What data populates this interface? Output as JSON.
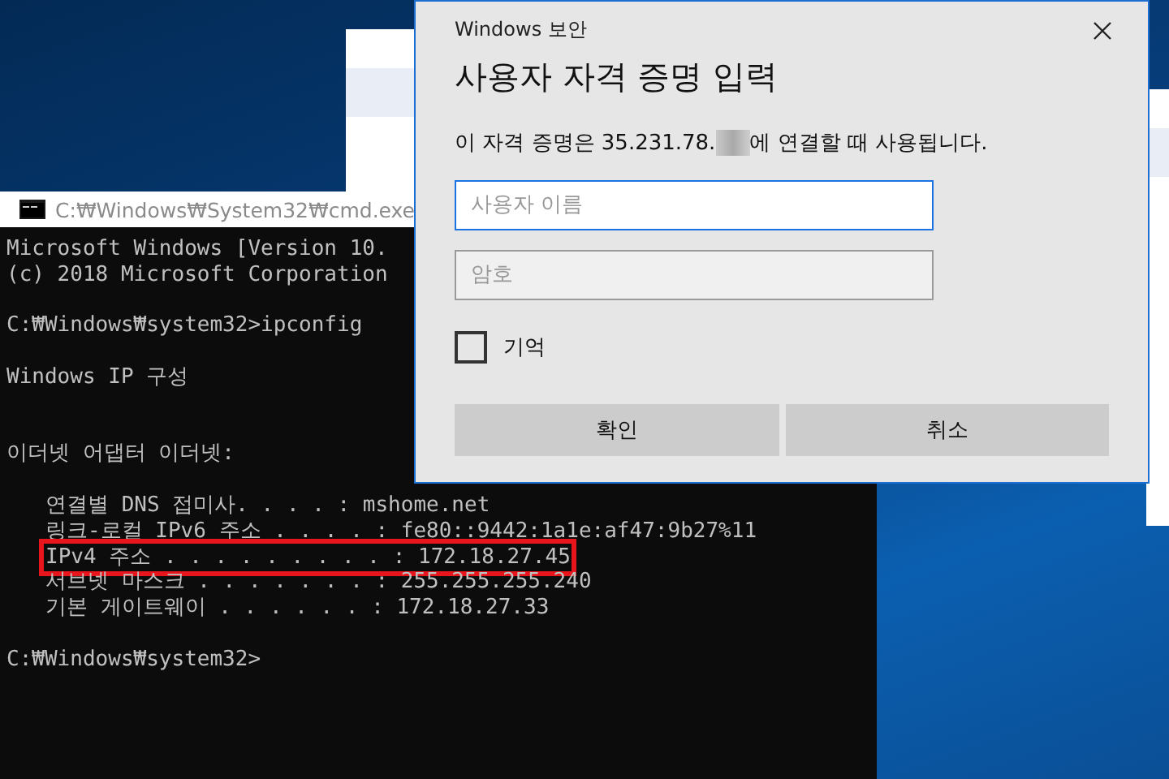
{
  "console_window": {
    "title": "C:₩Windows₩System32₩cmd.exe",
    "blocks": [
      {
        "lines": [
          {
            "text": "Microsoft Windows [Version 10."
          },
          {
            "text": "(c) 2018 Microsoft Corporation"
          }
        ]
      },
      {
        "lines": [
          {
            "text": "C:₩Windows₩system32>ipconfig"
          }
        ]
      },
      {
        "lines": [
          {
            "text": "Windows IP 구성"
          }
        ]
      },
      {
        "lines": [
          {
            "text": "이더넷 어댑터 이더넷:"
          }
        ],
        "children": [
          {
            "text": "연결별 DNS 접미사. . . . : mshome.net",
            "highlighted": false
          },
          {
            "text": "링크-로컬 IPv6 주소 . . . . : fe80::9442:1a1e:af47:9b27%11",
            "highlighted": false
          },
          {
            "text": "IPv4 주소 . . . . . . . . . : 172.18.27.45",
            "highlighted": true
          },
          {
            "text": "서브넷 마스크 . . . . . . . : 255.255.255.240",
            "highlighted": false
          },
          {
            "text": "기본 게이트웨이 . . . . . . : 172.18.27.33",
            "highlighted": false
          }
        ]
      },
      {
        "lines": [
          {
            "text": "C:₩Windows₩system32>"
          }
        ]
      }
    ]
  },
  "dialog": {
    "title": "Windows 보안",
    "heading": "사용자 자격 증명 입력",
    "message_before": "이 자격 증명은 35.231.78.",
    "message_after": "에 연결할 때 사용됩니다.",
    "fields": [
      {
        "placeholder": "사용자 이름",
        "focused": true
      },
      {
        "placeholder": "암호",
        "focused": false
      }
    ],
    "remember": {
      "label": "기억",
      "checked": false
    },
    "buttons": [
      "확인",
      "취소"
    ]
  }
}
